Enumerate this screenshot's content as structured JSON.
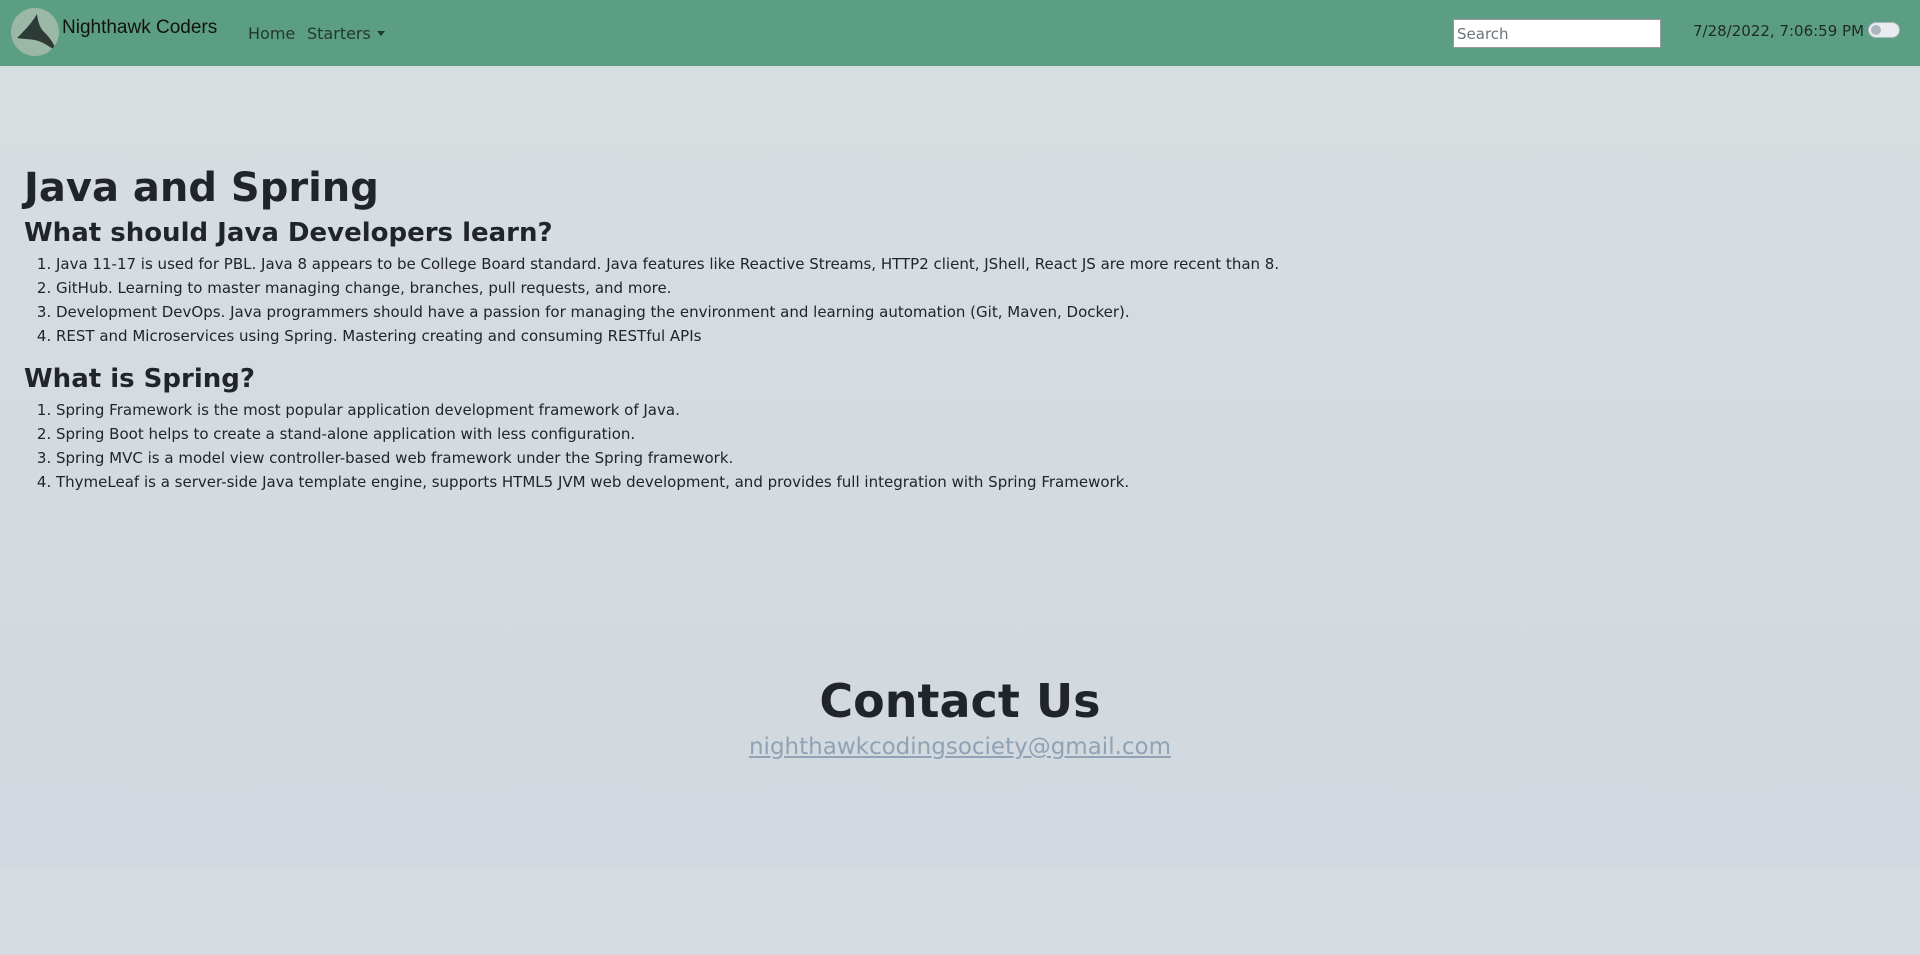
{
  "navbar": {
    "brand": "Nighthawk Coders",
    "links": [
      {
        "label": "Home"
      },
      {
        "label": "Starters"
      }
    ],
    "search_placeholder": "Search",
    "datetime": "7/28/2022, 7:06:59 PM",
    "theme_toggle_on": false
  },
  "main": {
    "title": "Java and Spring",
    "sections": [
      {
        "heading": "What should Java Developers learn?",
        "items": [
          "Java 11-17 is used for PBL. Java 8 appears to be College Board standard. Java features like Reactive Streams, HTTP2 client, JShell, React JS are more recent than 8.",
          "GitHub. Learning to master managing change, branches, pull requests, and more.",
          "Development DevOps. Java programmers should have a passion for managing the environment and learning automation (Git, Maven, Docker).",
          "REST and Microservices using Spring. Mastering creating and consuming RESTful APIs"
        ]
      },
      {
        "heading": "What is Spring?",
        "items": [
          "Spring Framework is the most popular application development framework of Java.",
          "Spring Boot helps to create a stand-alone application with less configuration.",
          "Spring MVC is a model view controller-based web framework under the Spring framework.",
          "ThymeLeaf is a server-side Java template engine, supports HTML5 JVM web development, and provides full integration with Spring Framework."
        ]
      }
    ]
  },
  "contact": {
    "heading": "Contact Us",
    "email": "nighthawkcodingsociety@gmail.com"
  },
  "colors": {
    "navbar": "#5c9e83",
    "background": "#d4dcdf",
    "link": "#8fa3b4"
  }
}
